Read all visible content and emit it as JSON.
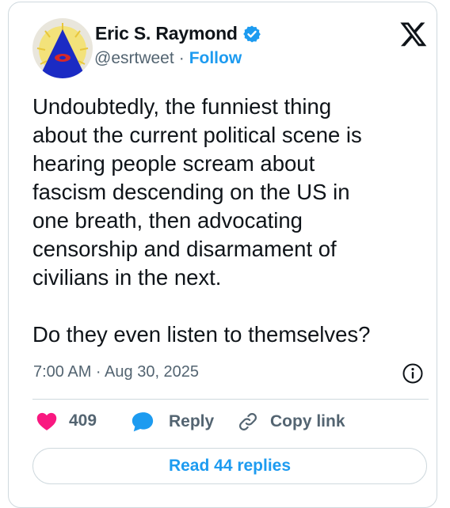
{
  "author": {
    "name": "Eric S. Raymond",
    "handle": "@esrtweet",
    "separator": "·",
    "follow_label": "Follow"
  },
  "icons": {
    "verified": "verified-badge-icon",
    "brand": "x-logo-icon",
    "info": "info-icon",
    "heart": "heart-icon",
    "reply": "reply-bubble-icon",
    "copy_link": "link-icon"
  },
  "tweet": {
    "text": "Undoubtedly, the funniest thing\nabout the current political scene is\nhearing people scream about\nfascism descending on the US in\none breath, then advocating\ncensorship and disarmament of\ncivilians in the next.\n\nDo they even listen to themselves?",
    "timestamp": "7:00 AM · Aug 30, 2025"
  },
  "actions": {
    "like_count": "409",
    "reply_label": "Reply",
    "copy_link_label": "Copy link"
  },
  "footer": {
    "read_replies_label": "Read 44 replies"
  },
  "colors": {
    "accent": "#1d9bf0",
    "heart": "#f91880",
    "secondary_text": "#536471",
    "border": "#cfd9de"
  }
}
